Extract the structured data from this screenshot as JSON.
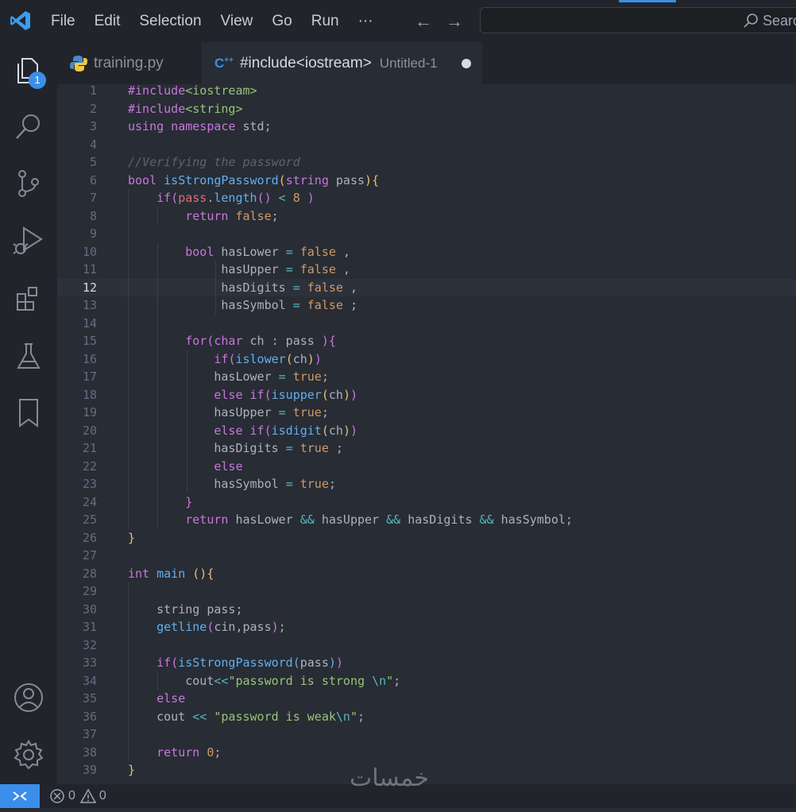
{
  "menu": [
    "File",
    "Edit",
    "Selection",
    "View",
    "Go",
    "Run",
    "···"
  ],
  "search": {
    "placeholder": "Search"
  },
  "explorer_badge": "1",
  "tabs": [
    {
      "name": "training.py",
      "desc": "",
      "icon": "python-icon"
    },
    {
      "name": "#include<iostream>",
      "desc": "Untitled-1",
      "icon": "cpp-icon",
      "modified": true
    }
  ],
  "current_line": 12,
  "code_lines": [
    {
      "n": "1",
      "tokens": [
        [
          "kw",
          "#include"
        ],
        [
          "str",
          "<iostream>"
        ]
      ]
    },
    {
      "n": "2",
      "tokens": [
        [
          "kw",
          "#include"
        ],
        [
          "str",
          "<string>"
        ]
      ]
    },
    {
      "n": "3",
      "tokens": [
        [
          "kw",
          "using namespace"
        ],
        [
          "pl",
          " std;"
        ]
      ]
    },
    {
      "n": "4",
      "tokens": []
    },
    {
      "n": "5",
      "tokens": [
        [
          "cm",
          "//Verifying the password"
        ]
      ]
    },
    {
      "n": "6",
      "tokens": [
        [
          "ty",
          "bool"
        ],
        [
          "pl",
          " "
        ],
        [
          "fn",
          "isStrongPassword"
        ],
        [
          "br",
          "("
        ],
        [
          "ty",
          "string"
        ],
        [
          "pl",
          " pass"
        ],
        [
          "br",
          ")"
        ],
        [
          "br",
          "{"
        ]
      ]
    },
    {
      "n": "7",
      "tokens": [
        [
          "pl",
          "    "
        ],
        [
          "kw",
          "if"
        ],
        [
          "kw",
          "("
        ],
        [
          "var",
          "pass"
        ],
        [
          "pl",
          "."
        ],
        [
          "fn",
          "length"
        ],
        [
          "kw",
          "()"
        ],
        [
          "pl",
          " "
        ],
        [
          "op",
          "<"
        ],
        [
          "pl",
          " "
        ],
        [
          "num",
          "8"
        ],
        [
          "pl",
          " "
        ],
        [
          "kw",
          ")"
        ]
      ]
    },
    {
      "n": "8",
      "tokens": [
        [
          "pl",
          "        "
        ],
        [
          "kw",
          "return"
        ],
        [
          "pl",
          " "
        ],
        [
          "bool",
          "false"
        ],
        [
          "pl",
          ";"
        ]
      ]
    },
    {
      "n": "9",
      "tokens": []
    },
    {
      "n": "10",
      "tokens": [
        [
          "pl",
          "        "
        ],
        [
          "ty",
          "bool"
        ],
        [
          "pl",
          " hasLower "
        ],
        [
          "op",
          "="
        ],
        [
          "pl",
          " "
        ],
        [
          "bool",
          "false"
        ],
        [
          "pl",
          " ,"
        ]
      ]
    },
    {
      "n": "11",
      "tokens": [
        [
          "pl",
          "             hasUpper "
        ],
        [
          "op",
          "="
        ],
        [
          "pl",
          " "
        ],
        [
          "bool",
          "false"
        ],
        [
          "pl",
          " ,"
        ]
      ]
    },
    {
      "n": "12",
      "tokens": [
        [
          "pl",
          "             hasDigits "
        ],
        [
          "op",
          "="
        ],
        [
          "pl",
          " "
        ],
        [
          "bool",
          "false"
        ],
        [
          "pl",
          " ,"
        ]
      ]
    },
    {
      "n": "13",
      "tokens": [
        [
          "pl",
          "             hasSymbol "
        ],
        [
          "op",
          "="
        ],
        [
          "pl",
          " "
        ],
        [
          "bool",
          "false"
        ],
        [
          "pl",
          " ;"
        ]
      ]
    },
    {
      "n": "14",
      "tokens": []
    },
    {
      "n": "15",
      "tokens": [
        [
          "pl",
          "        "
        ],
        [
          "kw",
          "for"
        ],
        [
          "kw",
          "("
        ],
        [
          "ty",
          "char"
        ],
        [
          "pl",
          " ch : pass "
        ],
        [
          "kw",
          ")"
        ],
        [
          "kw",
          "{"
        ]
      ]
    },
    {
      "n": "16",
      "tokens": [
        [
          "pl",
          "            "
        ],
        [
          "kw",
          "if"
        ],
        [
          "kw",
          "("
        ],
        [
          "fn",
          "islower"
        ],
        [
          "br",
          "("
        ],
        [
          "pl",
          "ch"
        ],
        [
          "br",
          ")"
        ],
        [
          "kw",
          ")"
        ]
      ]
    },
    {
      "n": "17",
      "tokens": [
        [
          "pl",
          "            hasLower "
        ],
        [
          "op",
          "="
        ],
        [
          "pl",
          " "
        ],
        [
          "bool",
          "true"
        ],
        [
          "pl",
          ";"
        ]
      ]
    },
    {
      "n": "18",
      "tokens": [
        [
          "pl",
          "            "
        ],
        [
          "kw",
          "else if"
        ],
        [
          "kw",
          "("
        ],
        [
          "fn",
          "isupper"
        ],
        [
          "br",
          "("
        ],
        [
          "pl",
          "ch"
        ],
        [
          "br",
          ")"
        ],
        [
          "kw",
          ")"
        ]
      ]
    },
    {
      "n": "19",
      "tokens": [
        [
          "pl",
          "            hasUpper "
        ],
        [
          "op",
          "="
        ],
        [
          "pl",
          " "
        ],
        [
          "bool",
          "true"
        ],
        [
          "pl",
          ";"
        ]
      ]
    },
    {
      "n": "20",
      "tokens": [
        [
          "pl",
          "            "
        ],
        [
          "kw",
          "else if"
        ],
        [
          "kw",
          "("
        ],
        [
          "fn",
          "isdigit"
        ],
        [
          "br",
          "("
        ],
        [
          "pl",
          "ch"
        ],
        [
          "br",
          ")"
        ],
        [
          "kw",
          ")"
        ]
      ]
    },
    {
      "n": "21",
      "tokens": [
        [
          "pl",
          "            hasDigits "
        ],
        [
          "op",
          "="
        ],
        [
          "pl",
          " "
        ],
        [
          "bool",
          "true"
        ],
        [
          "pl",
          " ;"
        ]
      ]
    },
    {
      "n": "22",
      "tokens": [
        [
          "pl",
          "            "
        ],
        [
          "kw",
          "else"
        ]
      ]
    },
    {
      "n": "23",
      "tokens": [
        [
          "pl",
          "            hasSymbol "
        ],
        [
          "op",
          "="
        ],
        [
          "pl",
          " "
        ],
        [
          "bool",
          "true"
        ],
        [
          "pl",
          ";"
        ]
      ]
    },
    {
      "n": "24",
      "tokens": [
        [
          "pl",
          "        "
        ],
        [
          "kw",
          "}"
        ]
      ]
    },
    {
      "n": "25",
      "tokens": [
        [
          "pl",
          "        "
        ],
        [
          "kw",
          "return"
        ],
        [
          "pl",
          " hasLower "
        ],
        [
          "op",
          "&&"
        ],
        [
          "pl",
          " hasUpper "
        ],
        [
          "op",
          "&&"
        ],
        [
          "pl",
          " hasDigits "
        ],
        [
          "op",
          "&&"
        ],
        [
          "pl",
          " hasSymbol;"
        ]
      ]
    },
    {
      "n": "26",
      "tokens": [
        [
          "br",
          "}"
        ]
      ]
    },
    {
      "n": "27",
      "tokens": []
    },
    {
      "n": "28",
      "tokens": [
        [
          "ty",
          "int"
        ],
        [
          "pl",
          " "
        ],
        [
          "fn",
          "main"
        ],
        [
          "pl",
          " "
        ],
        [
          "br",
          "()"
        ],
        [
          "br",
          "{"
        ]
      ]
    },
    {
      "n": "29",
      "tokens": []
    },
    {
      "n": "30",
      "tokens": [
        [
          "pl",
          "    string pass;"
        ]
      ]
    },
    {
      "n": "31",
      "tokens": [
        [
          "pl",
          "    "
        ],
        [
          "fn",
          "getline"
        ],
        [
          "kw",
          "("
        ],
        [
          "pl",
          "cin,pass"
        ],
        [
          "kw",
          ")"
        ],
        [
          "pl",
          ";"
        ]
      ]
    },
    {
      "n": "32",
      "tokens": []
    },
    {
      "n": "33",
      "tokens": [
        [
          "pl",
          "    "
        ],
        [
          "kw",
          "if"
        ],
        [
          "kw",
          "("
        ],
        [
          "fn",
          "isStrongPassword"
        ],
        [
          "fn",
          "("
        ],
        [
          "pl",
          "pass"
        ],
        [
          "fn",
          ")"
        ],
        [
          "kw",
          ")"
        ]
      ]
    },
    {
      "n": "34",
      "tokens": [
        [
          "pl",
          "        cout"
        ],
        [
          "op",
          "<<"
        ],
        [
          "str",
          "\"password is strong "
        ],
        [
          "esc",
          "\\n"
        ],
        [
          "str",
          "\""
        ],
        [
          "pl",
          ";"
        ]
      ]
    },
    {
      "n": "35",
      "tokens": [
        [
          "pl",
          "    "
        ],
        [
          "kw",
          "else"
        ]
      ]
    },
    {
      "n": "36",
      "tokens": [
        [
          "pl",
          "    cout "
        ],
        [
          "op",
          "<<"
        ],
        [
          "pl",
          " "
        ],
        [
          "str",
          "\"password is weak"
        ],
        [
          "esc",
          "\\n"
        ],
        [
          "str",
          "\""
        ],
        [
          "pl",
          ";"
        ]
      ]
    },
    {
      "n": "37",
      "tokens": []
    },
    {
      "n": "38",
      "tokens": [
        [
          "pl",
          "    "
        ],
        [
          "kw",
          "return"
        ],
        [
          "pl",
          " "
        ],
        [
          "num",
          "0"
        ],
        [
          "pl",
          ";"
        ]
      ]
    },
    {
      "n": "39",
      "tokens": [
        [
          "br",
          "}"
        ]
      ]
    }
  ],
  "status": {
    "errors": "0",
    "warnings": "0"
  },
  "watermark": "خمسات"
}
